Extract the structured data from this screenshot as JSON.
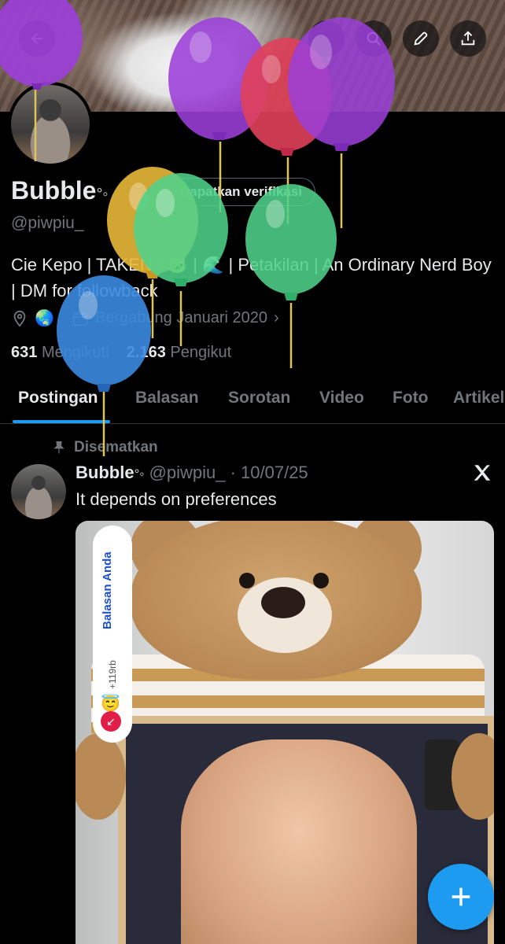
{
  "profile": {
    "name": "Bubble",
    "name_suffix_icon": "bubbles-emoji-icon",
    "verify_label": "Dapatkan verifikasi",
    "handle": "@piwpiu_",
    "bio": "Cie Kepo | TAKEN | 🐱 | 🌊 | Petakilan | An Ordinary Nerd Boy | DM for followback",
    "location_emoji": "🌏",
    "joined": "Bergabung Januari 2020",
    "following_count": "631",
    "following_label": "Mengikuti",
    "followers_count": "2.163",
    "followers_label": "Pengikut"
  },
  "tabs": [
    {
      "label": "Postingan",
      "active": true
    },
    {
      "label": "Balasan"
    },
    {
      "label": "Sorotan"
    },
    {
      "label": "Video"
    },
    {
      "label": "Foto"
    },
    {
      "label": "Artikel"
    }
  ],
  "post": {
    "pinned_label": "Disematkan",
    "author": "Bubble",
    "handle": "@piwpiu_",
    "separator": "·",
    "date": "10/07/25",
    "text": "It depends on preferences",
    "reply_badge": {
      "label": "Balasan Anda",
      "count": "+119rb",
      "emoji": "😇"
    }
  },
  "colors": {
    "accent": "#1d9bf0",
    "background": "#000000",
    "text_primary": "#e7e9ea",
    "text_secondary": "#71767b",
    "balloon_purple": "#9b3fd8",
    "balloon_red": "#e0405a",
    "balloon_yellow": "#e8b838",
    "balloon_green": "#4fd18a",
    "balloon_blue": "#3b8be0"
  },
  "icons": {
    "back": "arrow-left-icon",
    "edit": "pencil-icon",
    "share": "upload-icon",
    "location": "location-pin-icon",
    "calendar": "calendar-icon",
    "pin": "pushpin-icon",
    "x_logo": "x-logo-icon",
    "fab": "plus-icon"
  }
}
